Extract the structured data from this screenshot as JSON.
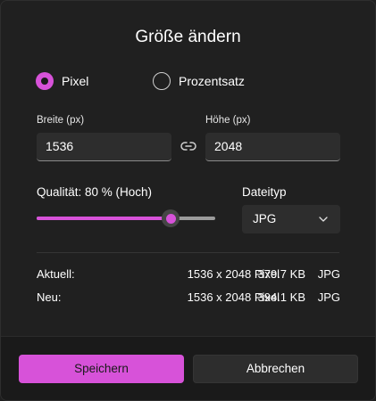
{
  "dialog": {
    "title": "Größe ändern"
  },
  "mode": {
    "options": [
      {
        "label": "Pixel",
        "selected": true
      },
      {
        "label": "Prozentsatz",
        "selected": false
      }
    ]
  },
  "dimensions": {
    "width_label": "Breite  (px)",
    "width_value": "1536",
    "height_label": "Höhe  (px)",
    "height_value": "2048",
    "link_icon": "link-icon"
  },
  "quality": {
    "label": "Qualität: 80 % (Hoch)",
    "value_percent": 80
  },
  "filetype": {
    "label": "Dateityp",
    "selected": "JPG",
    "icon": "chevron-down-icon"
  },
  "info": {
    "current": {
      "label": "Aktuell:",
      "dimensions": "1536 x 2048 Pixel",
      "size": "379.7 KB",
      "format": "JPG"
    },
    "new": {
      "label": "Neu:",
      "dimensions": "1536 x 2048 Pixel",
      "size": "394.1 KB",
      "format": "JPG"
    }
  },
  "buttons": {
    "save_label": "Speichern",
    "cancel_label": "Abbrechen"
  },
  "colors": {
    "accent": "#d752d9",
    "background": "#202020",
    "control": "#2d2d2d"
  }
}
